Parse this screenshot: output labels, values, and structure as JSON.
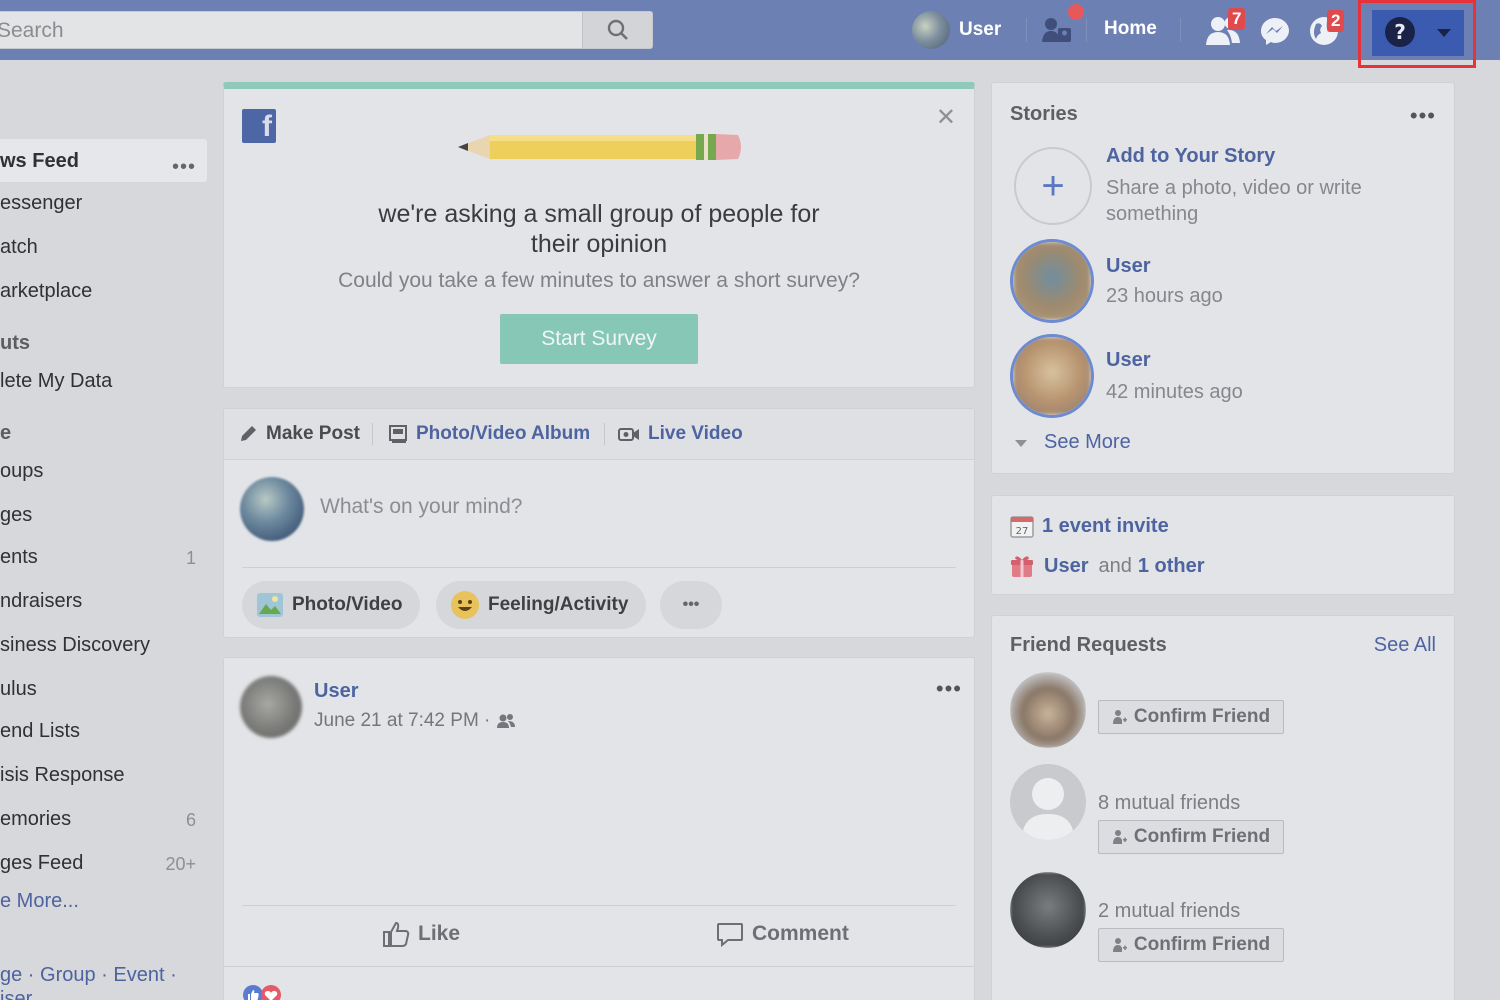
{
  "topbar": {
    "search_placeholder": "Search",
    "user_name": "User",
    "home_label": "Home",
    "friend_requests_badge": "7",
    "notifications_badge": "2"
  },
  "sidebar": {
    "items": [
      {
        "label": "ws Feed"
      },
      {
        "label": "essenger"
      },
      {
        "label": "atch"
      },
      {
        "label": "arketplace"
      }
    ],
    "shortcuts_heading": "uts",
    "shortcut_item": "lete My Data",
    "explore_heading": "e",
    "explore_items": [
      {
        "label": "oups",
        "count": ""
      },
      {
        "label": "ges",
        "count": ""
      },
      {
        "label": "ents",
        "count": "1"
      },
      {
        "label": "ndraisers",
        "count": ""
      },
      {
        "label": "siness Discovery",
        "count": ""
      },
      {
        "label": "ulus",
        "count": ""
      },
      {
        "label": "end Lists",
        "count": ""
      },
      {
        "label": "isis Response",
        "count": ""
      },
      {
        "label": "emories",
        "count": "6"
      },
      {
        "label": "ges Feed",
        "count": "20+"
      }
    ],
    "see_more": "e More...",
    "create_links": "ge · Group · Event ·",
    "create_links_2": "iser"
  },
  "survey": {
    "title": "we're asking a small group of people for their opinion",
    "subtitle": "Could you take a few minutes to answer a short survey?",
    "button": "Start Survey"
  },
  "composer": {
    "tabs": [
      "Make Post",
      "Photo/Video Album",
      "Live Video"
    ],
    "placeholder": "What's on your mind?",
    "actions": [
      "Photo/Video",
      "Feeling/Activity"
    ]
  },
  "post": {
    "author": "User",
    "timestamp": "June 21 at 7:42 PM ·",
    "like": "Like",
    "comment": "Comment"
  },
  "stories": {
    "heading": "Stories",
    "add_title": "Add to Your Story",
    "add_sub": "Share a photo, video or write something",
    "items": [
      {
        "name": "User",
        "time": "23 hours ago"
      },
      {
        "name": "User",
        "time": "42 minutes ago"
      }
    ],
    "see_more": "See More"
  },
  "events": {
    "calendar_day": "27",
    "invite": "1 event invite",
    "birthday_user": "User",
    "birthday_and": "and",
    "birthday_other": "1 other"
  },
  "friend_requests": {
    "heading": "Friend Requests",
    "see_all": "See All",
    "confirm_label": "Confirm Friend",
    "items": [
      {
        "mutual": ""
      },
      {
        "mutual": "8 mutual friends"
      },
      {
        "mutual": "2 mutual friends"
      }
    ]
  }
}
